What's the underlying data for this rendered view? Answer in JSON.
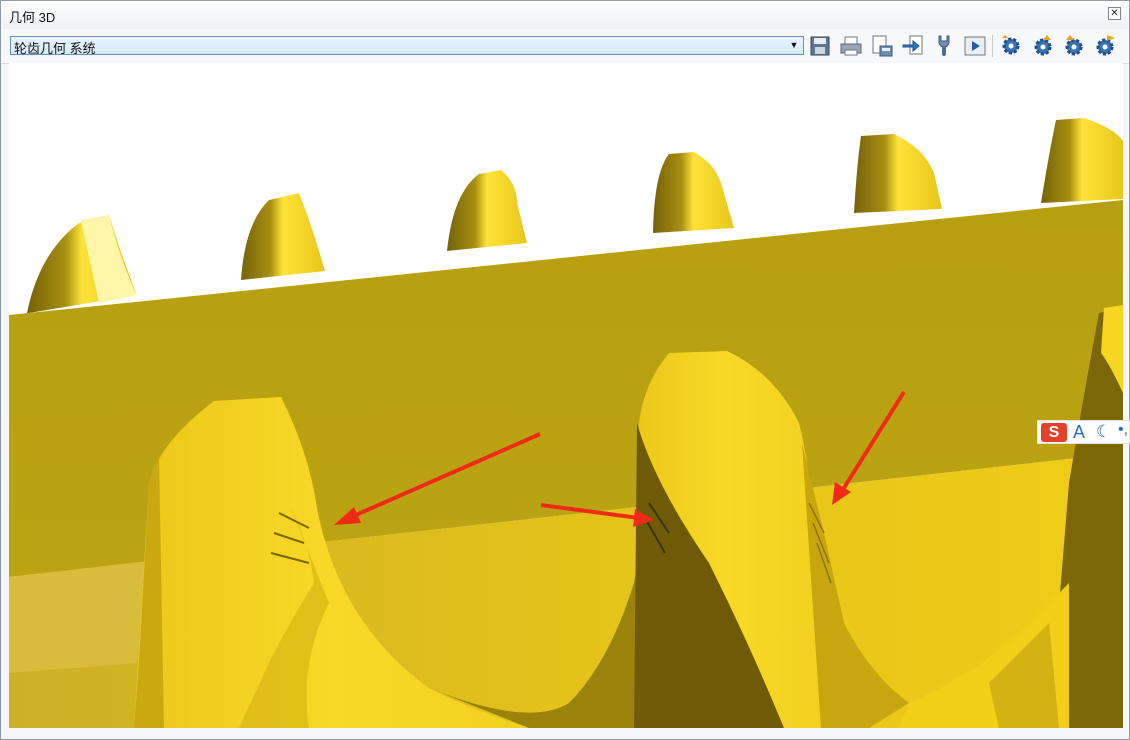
{
  "window": {
    "title": "几何 3D",
    "close_label": "✕"
  },
  "toolbar": {
    "combo_value": "轮齿几何 系统",
    "icons": [
      "save-icon",
      "print-icon",
      "print-preview-icon",
      "export-icon",
      "tool-icon",
      "play-icon",
      "settings-icon",
      "settings-up-icon",
      "settings-left-icon",
      "settings-right-icon"
    ]
  },
  "ime": {
    "logo": "S",
    "mode": "A",
    "moon": "☾",
    "punct": "•,"
  },
  "colors": {
    "tooth_bright": "#f9de2a",
    "tooth_mid": "#e8c617",
    "tooth_shadow": "#6e5c07",
    "band": "#b9a112",
    "arrow": "#f02a17"
  }
}
